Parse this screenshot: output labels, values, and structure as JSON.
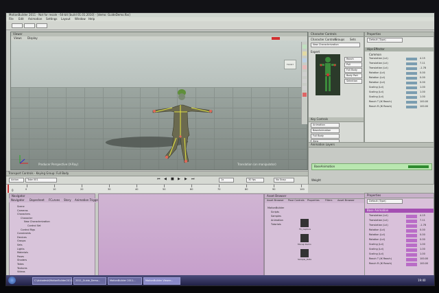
{
  "window": {
    "title": "MotionBuilder 2011 - Not for resale - 64-bit [build 01.01.2010] - [demo: GuideDemo.fbx]"
  },
  "menus": [
    "File",
    "Edit",
    "Animation",
    "Settings",
    "Layout",
    "Window",
    "Help"
  ],
  "viewer": {
    "title": "Viewer",
    "menu": [
      "Views",
      "Display"
    ],
    "camera_label": "Producer Perspective (X-Ray)",
    "status_label": "Translation (on manipulator)",
    "camera_cube": "FRONT"
  },
  "character_controls": {
    "title": "Character Controls",
    "tabs": [
      "Character Controls",
      "Groups",
      "Sets"
    ],
    "character": "New Characterization",
    "expert_label": "Expert",
    "buttons": [
      "Reach",
      "Pull",
      "Full Body",
      "Body Part",
      "Selection"
    ],
    "key_controls": {
      "title": "Key Controls",
      "rows": [
        "Animation",
        "BaseAnimation",
        "Full Body",
        "Zero",
        "Stance"
      ]
    }
  },
  "properties_top": {
    "title": "Properties",
    "object": "Default (Type)",
    "section": "Hips Effector",
    "group": "Common",
    "rows": [
      {
        "label": "Translation (Lcl)",
        "value": "4.15"
      },
      {
        "label": "Translation (Lcl)",
        "value": "7.11"
      },
      {
        "label": "Translation (Lcl)",
        "value": "-1.78"
      },
      {
        "label": "Rotation (Lcl)",
        "value": "0.00"
      },
      {
        "label": "Rotation (Lcl)",
        "value": "0.00"
      },
      {
        "label": "Rotation (Lcl)",
        "value": "0.00"
      },
      {
        "label": "Scaling (Lcl)",
        "value": "1.00"
      },
      {
        "label": "Scaling (Lcl)",
        "value": "1.00"
      },
      {
        "label": "Scaling (Lcl)",
        "value": "1.00"
      },
      {
        "label": "Reach T (IK Reach)",
        "value": "100.00"
      },
      {
        "label": "Reach R (IK Reach)",
        "value": "100.00"
      }
    ]
  },
  "animation_layers": {
    "title": "Animation Layers",
    "base_layer": "BaseAnimation",
    "weight_label": "Weight"
  },
  "transport": {
    "title": "Transport Controls - Keying Group: Full Body",
    "take": "Take 001",
    "mode": "Action",
    "speed": "1x",
    "fps": "30 fps",
    "snap": "No Snap",
    "current_frame": "0",
    "ruler": [
      "0",
      "10",
      "20",
      "30",
      "40",
      "50",
      "60",
      "70",
      "80",
      "90",
      "100"
    ]
  },
  "navigator": {
    "title": "Navigator",
    "tabs": [
      "Navigator",
      "Dopesheet",
      "FCurves",
      "Story",
      "Animation Trigger"
    ],
    "tree": [
      "Scene",
      "Cameras",
      "Characters",
      "Character",
      "New Characterization",
      "Control Set",
      "Control Rigs",
      "Constraints",
      "Devices",
      "Groups",
      "Sets",
      "Lights",
      "Materials",
      "Poses",
      "Shaders",
      "Takes",
      "Textures",
      "Videos"
    ]
  },
  "asset_browser": {
    "title": "Asset Browser",
    "tabs": [
      "Asset Browser",
      "Pose Controls",
      "Properties",
      "Filters",
      "Asset Browser"
    ],
    "tree": [
      "MotionBuilder",
      "Scripts",
      "Samples",
      "Animation",
      "Tutorials"
    ],
    "items": [
      "FK_Capture",
      "Mocap Demo",
      "Sample_Data"
    ]
  },
  "properties_bottom": {
    "title": "Properties",
    "object": "Default (Type)",
    "section": "Base Animation",
    "rows": [
      {
        "label": "Translation (Lcl)",
        "value": "4.15"
      },
      {
        "label": "Translation (Lcl)",
        "value": "7.11"
      },
      {
        "label": "Translation (Lcl)",
        "value": "-1.78"
      },
      {
        "label": "Rotation (Lcl)",
        "value": "0.00"
      },
      {
        "label": "Rotation (Lcl)",
        "value": "0.00"
      },
      {
        "label": "Rotation (Lcl)",
        "value": "0.00"
      },
      {
        "label": "Scaling (Lcl)",
        "value": "1.00"
      },
      {
        "label": "Scaling (Lcl)",
        "value": "1.00"
      },
      {
        "label": "Scaling (Lcl)",
        "value": "1.00"
      },
      {
        "label": "Reach T (IK Reach)",
        "value": "100.00"
      },
      {
        "label": "Reach R (IK Reach)",
        "value": "100.00"
      }
    ]
  },
  "taskbar": {
    "items": [
      "C:\\Autodesk\\MotionBuilder2011...",
      "2011_Guide_Demo...",
      "MotionBuilder 2011...",
      "MotionBuilder Viewer..."
    ],
    "clock": "19:40"
  }
}
